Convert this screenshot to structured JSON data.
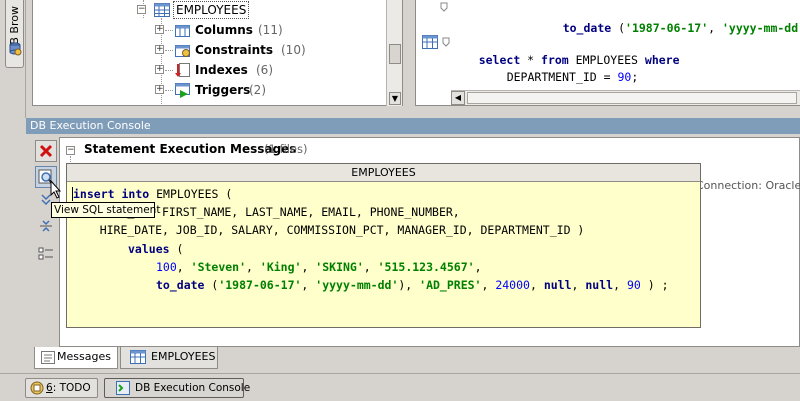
{
  "left_strip": {
    "db_browser_tab": "DB Brow"
  },
  "tree": {
    "items": [
      {
        "label": "EMPLOYEES",
        "count": ""
      },
      {
        "label": "Columns",
        "count": "(11)"
      },
      {
        "label": "Constraints",
        "count": "(10)"
      },
      {
        "label": "Indexes",
        "count": "(6)"
      },
      {
        "label": "Triggers",
        "count": "(2)"
      }
    ]
  },
  "sql_editor": {
    "line1": {
      "kw": "to_date",
      "open": " (",
      "s1": "'1987-06-17'",
      "comma": ", ",
      "s2": "'yyyy-mm-dd'",
      "tail": "),"
    },
    "line2": {
      "kw1": "select",
      "star": " * ",
      "kw2": "from",
      "table": " EMPLOYEES ",
      "kw3": "where"
    },
    "line3": {
      "col": "DEPARTMENT_ID = ",
      "num": "90",
      "end": ";"
    }
  },
  "console": {
    "title": "DB Execution Console",
    "messages_header": "Statement Execution Messages",
    "messages_count": "(1 files)",
    "connection_text": "Connection: Oracle XE"
  },
  "tooltip": "View SQL statement",
  "popup": {
    "title": "EMPLOYEES",
    "l1": {
      "kw1": "insert",
      "kw2": "into",
      "rest": " EMPLOYEES ("
    },
    "l2": {
      "rest": "        _ID, FIRST_NAME, LAST_NAME, EMAIL, PHONE_NUMBER,"
    },
    "l3": {
      "rest": "    HIRE_DATE, JOB_ID, SALARY, COMMISSION_PCT, MANAGER_ID, DEPARTMENT_ID )"
    },
    "l4": {
      "kw": "values",
      "rest": " ("
    },
    "l5": {
      "n1": "100",
      "c1": ", ",
      "s1": "'Steven'",
      "c2": ", ",
      "s2": "'King'",
      "c3": ", ",
      "s3": "'SKING'",
      "c4": ", ",
      "s4": "'515.123.4567'",
      "c5": ","
    },
    "l6": {
      "kw1": "to_date",
      "p1": " (",
      "s1": "'1987-06-17'",
      "c1": ", ",
      "s2": "'yyyy-mm-dd'",
      "c2": "), ",
      "s3": "'AD_PRES'",
      "c3": ", ",
      "n1": "24000",
      "c4": ", ",
      "kw2": "null",
      "c5": ", ",
      "kw3": "null",
      "c6": ", ",
      "n2": "90",
      "end": " ) ;"
    }
  },
  "console_tabs": {
    "messages": "Messages",
    "employees": "EMPLOYEES"
  },
  "status_bar": {
    "todo_key": "6",
    "todo_label": ": TODO",
    "db_console": "DB Execution Console"
  },
  "colors": {
    "title_bar": "#7f9db9",
    "keyword": "#000080",
    "string": "#008000",
    "number": "#0000ff",
    "popup_bg": "#ffffcc"
  }
}
